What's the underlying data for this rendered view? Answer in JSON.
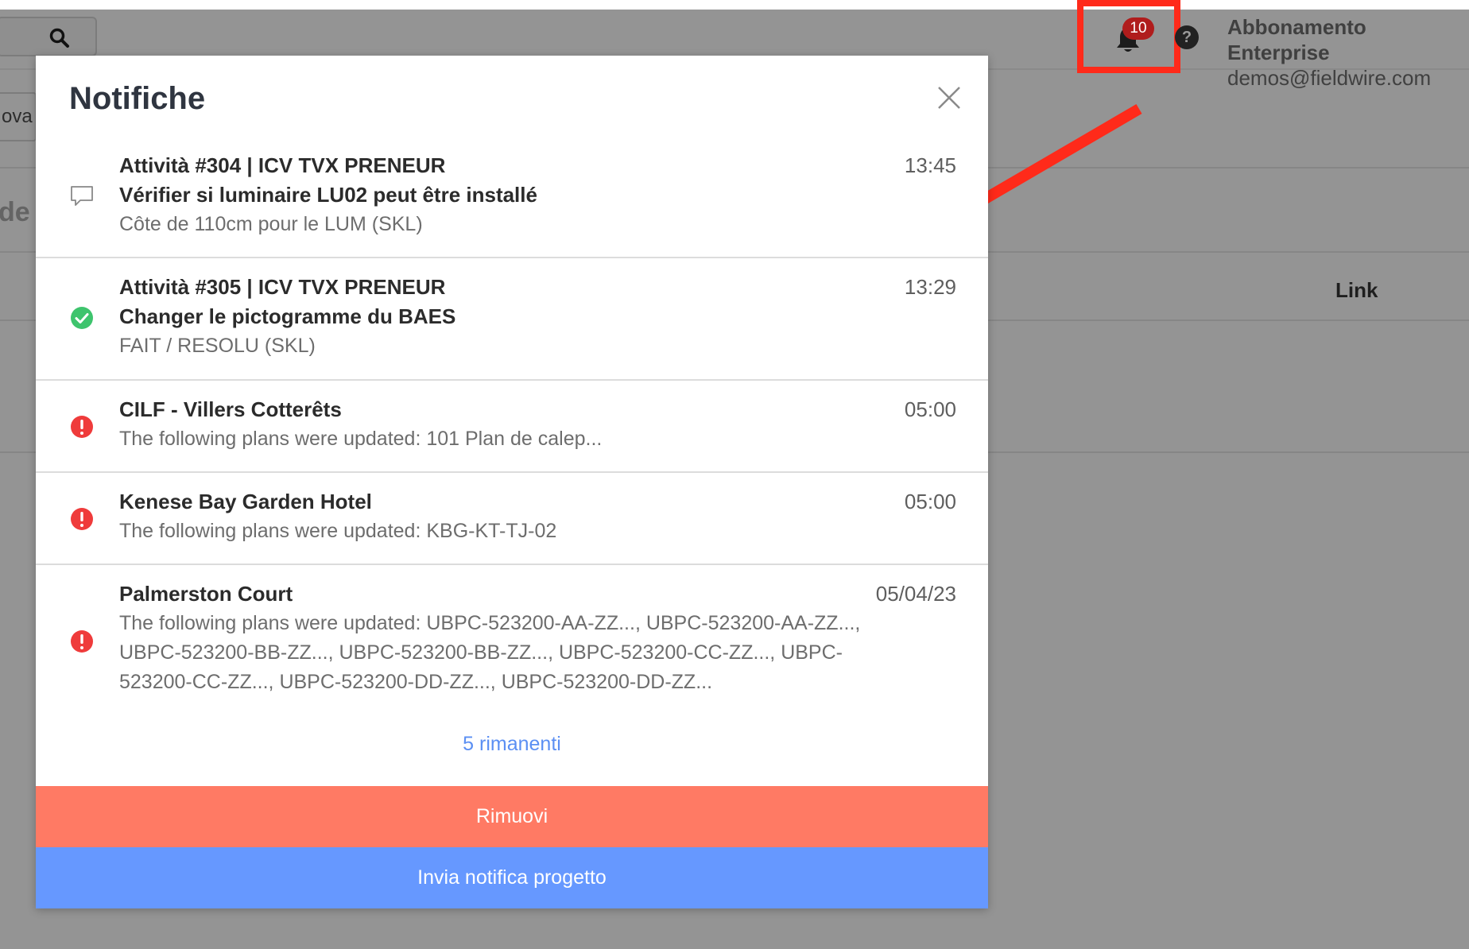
{
  "topbar": {
    "search_icon": "search-icon",
    "left_button_text": "ova",
    "left_heading_text": "de t",
    "notifications_count": "10",
    "account_plan": "Abbonamento Enterprise",
    "account_email": "demos@fieldwire.com"
  },
  "table": {
    "link_header": "Link"
  },
  "annotation": {
    "highlight_color": "#ff2a1a",
    "arrow_color": "#ff2a1a"
  },
  "modal": {
    "title": "Notifiche",
    "notifications": [
      {
        "icon": "comment-icon",
        "title": "Attività #304 | ICV TVX PRENEUR",
        "subtitle": "Vérifier si luminaire LU02 peut être installé",
        "desc": "Côte de 110cm pour le LUM (SKL)",
        "time": "13:45"
      },
      {
        "icon": "check-circle-icon",
        "title": "Attività #305 | ICV TVX PRENEUR",
        "subtitle": "Changer le pictogramme du BAES",
        "desc": "FAIT / RESOLU (SKL)",
        "time": "13:29"
      },
      {
        "icon": "alert-circle-icon",
        "title": "CILF - Villers Cotterêts",
        "desc": "The following plans were updated: 101 Plan de calep...",
        "time": "05:00"
      },
      {
        "icon": "alert-circle-icon",
        "title": "Kenese Bay Garden Hotel",
        "desc": "The following plans were updated: KBG-KT-TJ-02",
        "time": "05:00"
      },
      {
        "icon": "alert-circle-icon",
        "title": "Palmerston Court",
        "desc": "The following plans were updated: UBPC-523200-AA-ZZ..., UBPC-523200-AA-ZZ..., UBPC-523200-BB-ZZ..., UBPC-523200-BB-ZZ..., UBPC-523200-CC-ZZ..., UBPC-523200-CC-ZZ..., UBPC-523200-DD-ZZ..., UBPC-523200-DD-ZZ...",
        "time": "05/04/23"
      }
    ],
    "remaining_label": "5 rimanenti",
    "remove_label": "Rimuovi",
    "send_label": "Invia notifica progetto",
    "colors": {
      "remove": "#ff7a64",
      "send": "#6698ff",
      "link": "#5b8ff3",
      "success": "#3ec46d",
      "error": "#ef3b3b"
    }
  }
}
